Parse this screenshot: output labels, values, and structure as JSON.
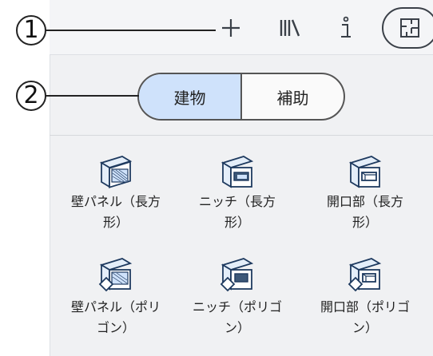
{
  "callouts": {
    "one": "1",
    "two": "2"
  },
  "toolbar": {
    "buttons": [
      "add-icon",
      "library-icon",
      "info-icon",
      "floorplan-icon"
    ]
  },
  "segmented": {
    "building": "建物",
    "auxiliary": "補助",
    "selected": "建物"
  },
  "items": [
    {
      "line1": "壁パネル（長方",
      "line2": "形）",
      "icon": "wall-panel-rect-icon"
    },
    {
      "line1": "ニッチ（長方",
      "line2": "形）",
      "icon": "niche-rect-icon"
    },
    {
      "line1": "開口部（長方",
      "line2": "形）",
      "icon": "opening-rect-icon"
    },
    {
      "line1": "壁パネル（ポリ",
      "line2": "ゴン）",
      "icon": "wall-panel-polygon-icon"
    },
    {
      "line1": "ニッチ（ポリゴ",
      "line2": "ン）",
      "icon": "niche-polygon-icon"
    },
    {
      "line1": "開口部（ポリゴ",
      "line2": "ン）",
      "icon": "opening-polygon-icon"
    }
  ],
  "colors": {
    "accent": "#cfe2fb",
    "panel": "#f0f1f3",
    "icon_stroke": "#1e3a5f",
    "icon_fill": "#cfe2fb"
  }
}
